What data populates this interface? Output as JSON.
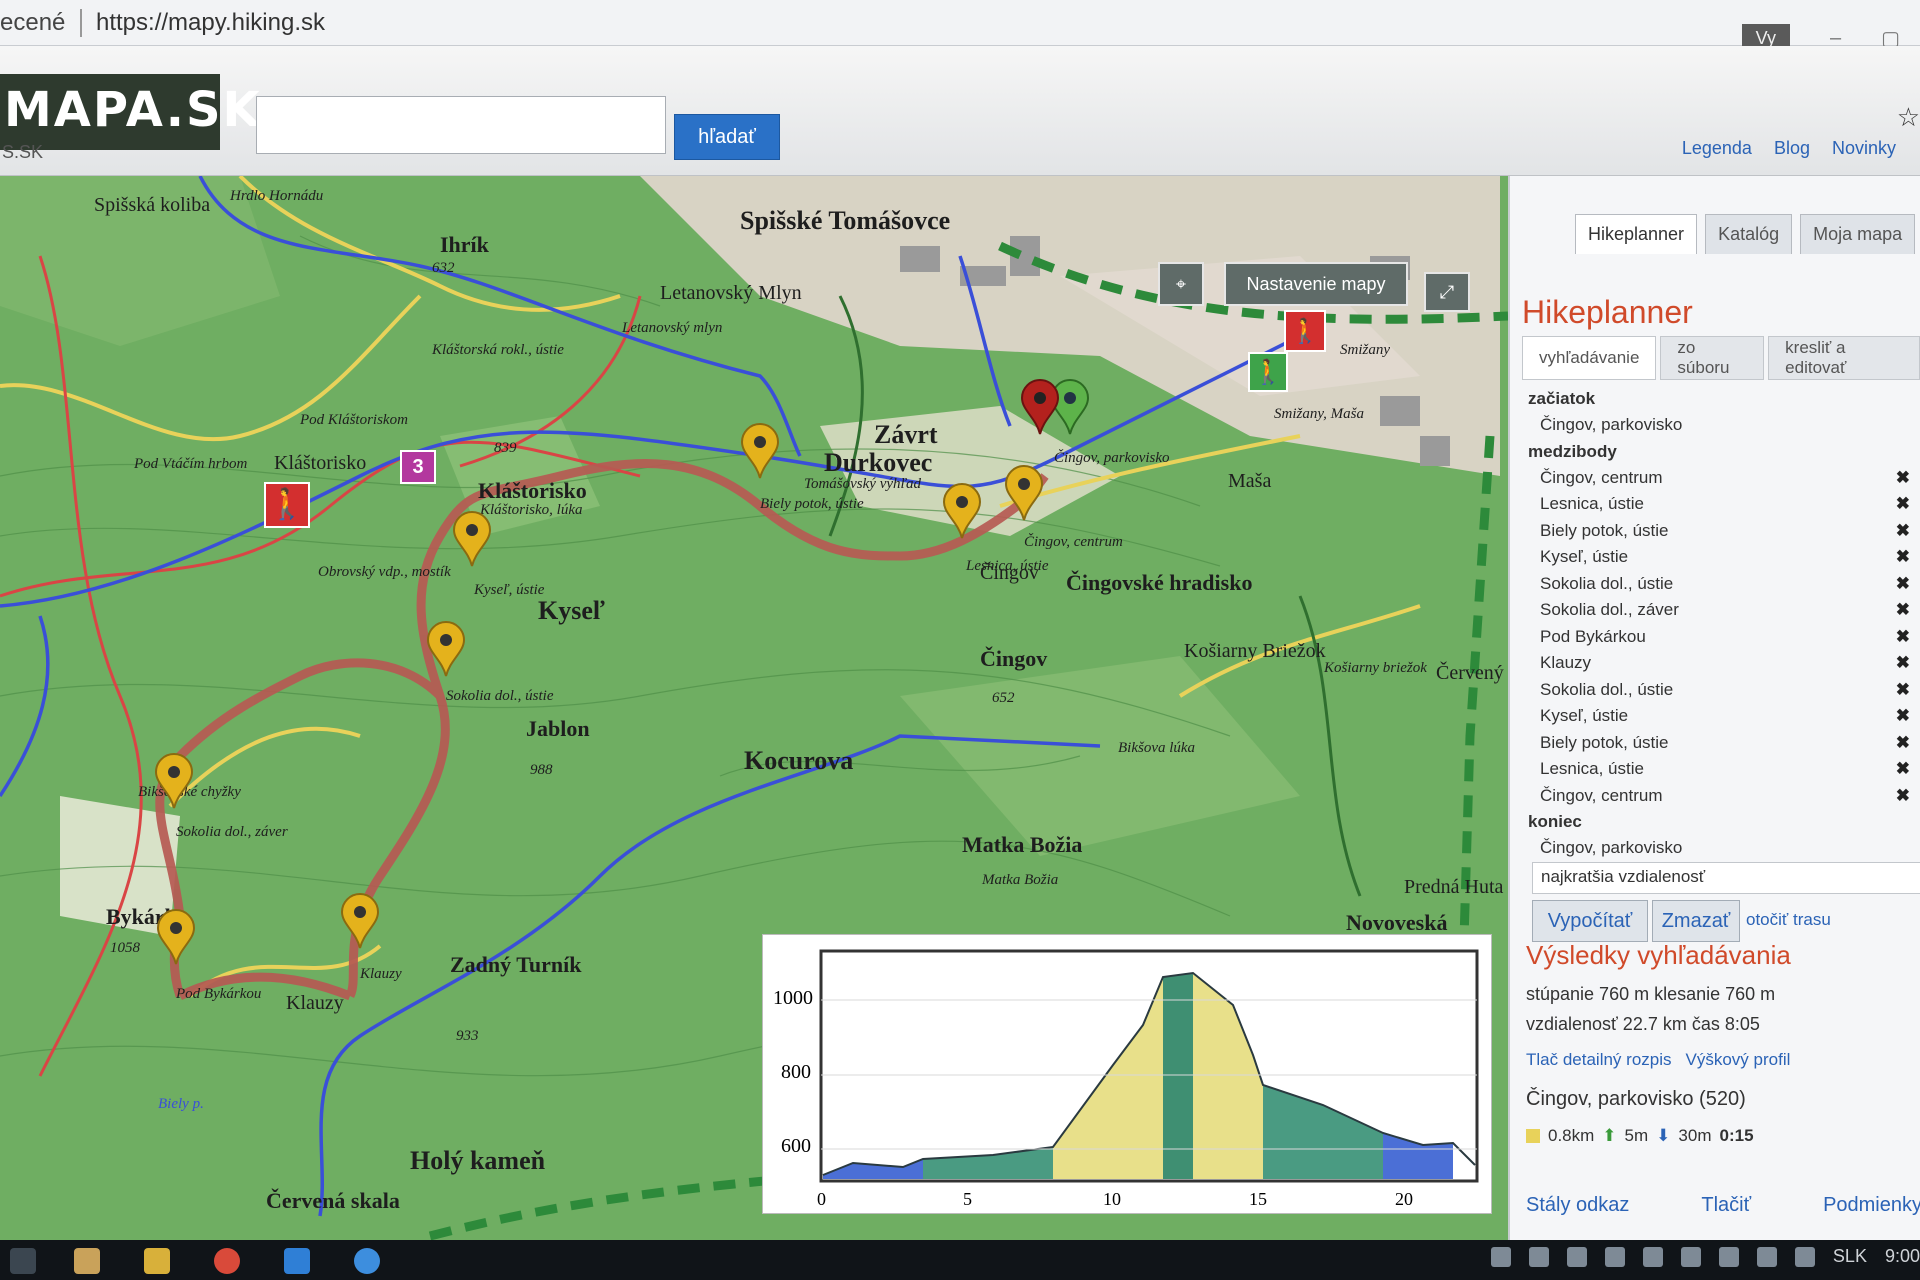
{
  "browser": {
    "prev_text": "ecené",
    "url": "https://mapy.hiking.sk",
    "user_chip": "Vy",
    "minimize": "–",
    "maximize": "▢"
  },
  "header": {
    "logo": "MAPA.SK",
    "logo_sub": "S.SK",
    "search_value": "",
    "search_button": "hľadať",
    "links": [
      "Legenda",
      "Blog",
      "Novinky"
    ],
    "star": "☆"
  },
  "map": {
    "controls": {
      "locate": "⌖",
      "settings": "Nastavenie mapy",
      "fullscreen": "⤢"
    },
    "labels": [
      "Spišská koliba",
      "Hrdlo Hornádu",
      "Ihrík",
      "632",
      "Spišské Tomášovce",
      "Letanovský Mlyn",
      "Letanovský mlyn",
      "Kláštorská rokl., ústie",
      "Pod Kláštoriskom",
      "Pod Vtáčím hrbom",
      "Kláštorisko",
      "839",
      "Kláštorisko",
      "Kláštorisko, lúka",
      "Závrt",
      "Durkovec",
      "Tomášovský výhľad",
      "Biely potok, ústie",
      "Smižany",
      "Smižany, Maša",
      "Maša",
      "Čingov, parkovisko",
      "Čingov, centrum",
      "Lesnica, ústie",
      "Čingov",
      "Čingovské hradisko",
      "Obrovský vdp., mostík",
      "Kyseľ, ústie",
      "Kyseľ",
      "Sokolia dol., ústie",
      "Jablon",
      "988",
      "Čingov",
      "652",
      "Košiarny Briežok",
      "Košiarny briežok",
      "Červený",
      "Kocurova",
      "Bikšova lúka",
      "Bikšovské chyžky",
      "Sokolia dol., záver",
      "Bykárka",
      "1058",
      "Pod Bykárkou",
      "Klauzy",
      "Klauzy",
      "Zadný Turník",
      "933",
      "Matka Božia",
      "Matka Božia",
      "Holý kameň",
      "Červená skala",
      "Predná Huta",
      "Novoveská",
      "Biely p."
    ],
    "marker_badge": "3",
    "colors": {
      "route": "#c0504d",
      "forest": "#5fa35c",
      "path_blue": "#3a4fd8",
      "path_yellow": "#e8d25a"
    }
  },
  "elevation": {
    "y_ticks": [
      "1000",
      "800",
      "600"
    ],
    "x_ticks": [
      "0",
      "5",
      "10",
      "15",
      "20"
    ]
  },
  "panel": {
    "tabs": [
      "Hikeplanner",
      "Katalóg",
      "Moja mapa"
    ],
    "title": "Hikeplanner",
    "subtabs": [
      "vyhľadávanie",
      "zo súboru",
      "kresliť a editovať"
    ],
    "start_heading": "začiatok",
    "start": "Čingov, parkovisko",
    "via_heading": "medzibody",
    "via": [
      "Čingov, centrum",
      "Lesnica, ústie",
      "Biely potok, ústie",
      "Kyseľ, ústie",
      "Sokolia dol., ústie",
      "Sokolia dol., záver",
      "Pod Bykárkou",
      "Klauzy",
      "Sokolia dol., ústie",
      "Kyseľ, ústie",
      "Biely potok, ústie",
      "Lesnica, ústie",
      "Čingov, centrum"
    ],
    "remove_icon": "✖",
    "end_heading": "koniec",
    "end": "Čingov, parkovisko",
    "mode": "najkratšia vzdialenosť",
    "compute_button": "Vypočítať",
    "clear_button": "Zmazať",
    "reverse_link": "otočiť trasu",
    "results_title": "Výsledky vyhľadávania",
    "climb_text": "stúpanie 760 m klesanie 760 m",
    "distance_text": "vzdialenosť 22.7 km čas 8:05",
    "print_detail": "Tlač detailný rozpis",
    "elevation_profile": "Výškový profil",
    "segment_title": "Čingov, parkovisko (520)",
    "segment_dist": "0.8km",
    "segment_up": "5m",
    "segment_down": "30m",
    "segment_time": "0:15",
    "footer": [
      "Stály odkaz",
      "Tlačiť",
      "Podmienky"
    ]
  },
  "taskbar": {
    "language": "SLK",
    "clock": "9:00"
  }
}
